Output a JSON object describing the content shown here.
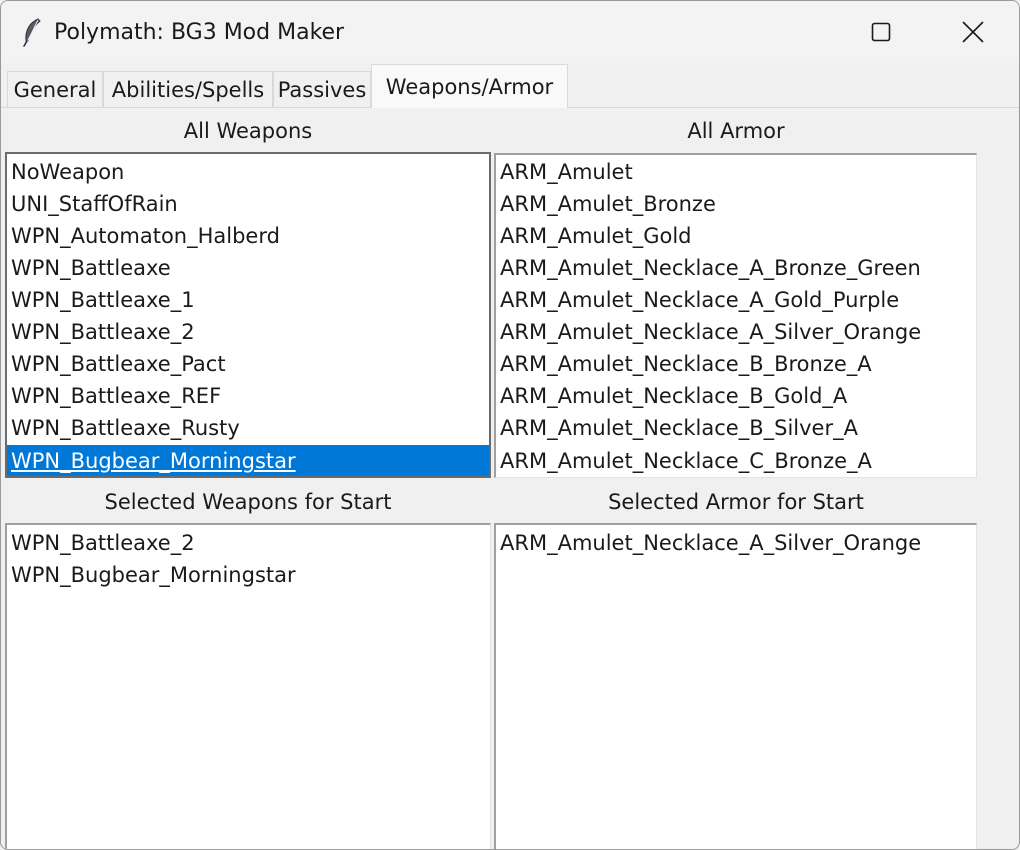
{
  "window": {
    "title": "Polymath: BG3 Mod Maker"
  },
  "tabs": [
    {
      "label": "General"
    },
    {
      "label": "Abilities/Spells"
    },
    {
      "label": "Passives"
    },
    {
      "label": "Weapons/Armor"
    }
  ],
  "active_tab": "Weapons/Armor",
  "all_weapons": {
    "label": "All Weapons",
    "items": [
      "NoWeapon",
      "UNI_StaffOfRain",
      "WPN_Automaton_Halberd",
      "WPN_Battleaxe",
      "WPN_Battleaxe_1",
      "WPN_Battleaxe_2",
      "WPN_Battleaxe_Pact",
      "WPN_Battleaxe_REF",
      "WPN_Battleaxe_Rusty",
      "WPN_Bugbear_Morningstar"
    ],
    "selected": "WPN_Bugbear_Morningstar"
  },
  "all_armor": {
    "label": "All Armor",
    "items": [
      "ARM_Amulet",
      "ARM_Amulet_Bronze",
      "ARM_Amulet_Gold",
      "ARM_Amulet_Necklace_A_Bronze_Green",
      "ARM_Amulet_Necklace_A_Gold_Purple",
      "ARM_Amulet_Necklace_A_Silver_Orange",
      "ARM_Amulet_Necklace_B_Bronze_A",
      "ARM_Amulet_Necklace_B_Gold_A",
      "ARM_Amulet_Necklace_B_Silver_A",
      "ARM_Amulet_Necklace_C_Bronze_A"
    ]
  },
  "selected_weapons": {
    "label": "Selected Weapons for Start",
    "items": [
      "WPN_Battleaxe_2",
      "WPN_Bugbear_Morningstar"
    ]
  },
  "selected_armor": {
    "label": "Selected Armor for Start",
    "items": [
      "ARM_Amulet_Necklace_A_Silver_Orange"
    ]
  },
  "icons": {
    "app": "feather-icon",
    "minimize": "minimize-icon",
    "maximize": "maximize-icon",
    "close": "close-icon"
  },
  "colors": {
    "selection": "#0078d7",
    "window_bg": "#f0f0f0",
    "list_bg": "#ffffff"
  }
}
